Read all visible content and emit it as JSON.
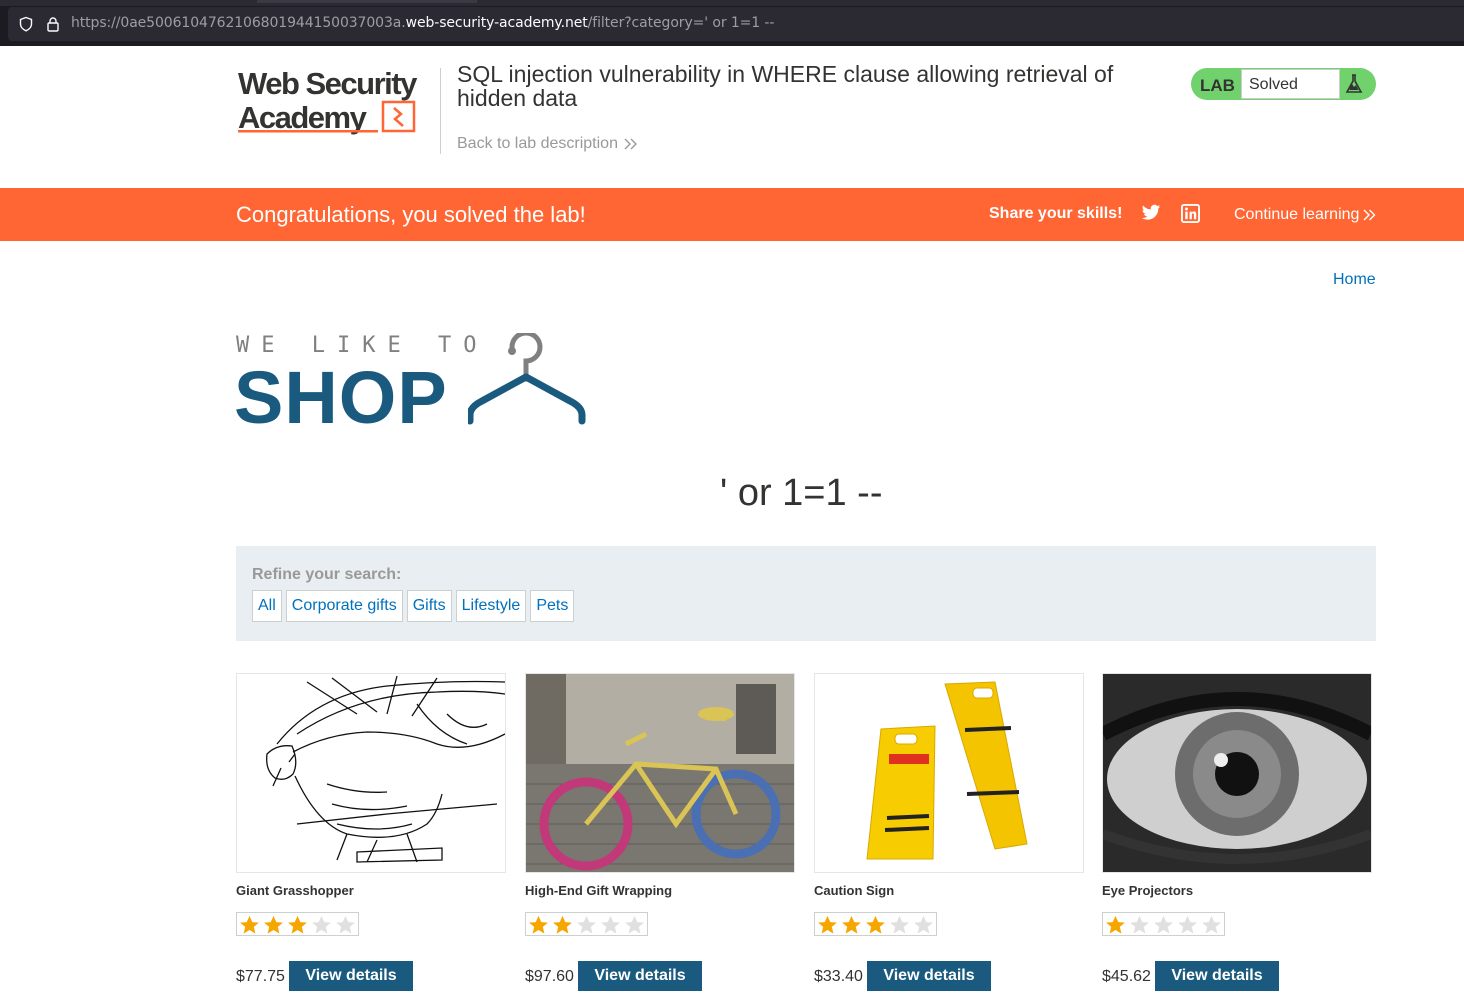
{
  "browser": {
    "url_prefix": "https://0ae500610476210680194415003700 3a.",
    "url_prefix_exact": "https://0ae500610476210680194415003 7003a.",
    "url_start": "https://0ae50061047621068019441500",
    "url_mid": "37003a.",
    "url_domain": "web-security-academy.net",
    "url_path": "/filter?category=' or 1=1 --"
  },
  "academy": {
    "lab_title": "SQL injection vulnerability in WHERE clause allowing retrieval of hidden data",
    "back_link": "Back to lab description",
    "lab_label": "LAB",
    "lab_status": "Solved"
  },
  "banner": {
    "congrats": "Congratulations, you solved the lab!",
    "share": "Share your skills!",
    "continue": "Continue learning",
    "color": "#ff6633"
  },
  "nav": {
    "home": "Home"
  },
  "logo": {
    "tagline": "WE LIKE TO",
    "word": "SHOP"
  },
  "search": {
    "heading": "' or 1=1 --"
  },
  "filters": {
    "label": "Refine your search:",
    "items": [
      "All",
      "Corporate gifts",
      "Gifts",
      "Lifestyle",
      "Pets"
    ]
  },
  "products": [
    {
      "name": "Giant Grasshopper",
      "rating": 3,
      "price": "$77.75",
      "button": "View details",
      "image": "grasshopper-sketch"
    },
    {
      "name": "High-End Gift Wrapping",
      "rating": 2,
      "price": "$97.60",
      "button": "View details",
      "image": "knitted-bicycle"
    },
    {
      "name": "Caution Sign",
      "rating": 3,
      "price": "$33.40",
      "button": "View details",
      "image": "caution-signs"
    },
    {
      "name": "Eye Projectors",
      "rating": 1,
      "price": "$45.62",
      "button": "View details",
      "image": "eye-closeup"
    }
  ],
  "colors": {
    "accent": "#1a5a7e",
    "link": "#0071bc",
    "solved": "#70d16d",
    "star": "#f7a600"
  }
}
